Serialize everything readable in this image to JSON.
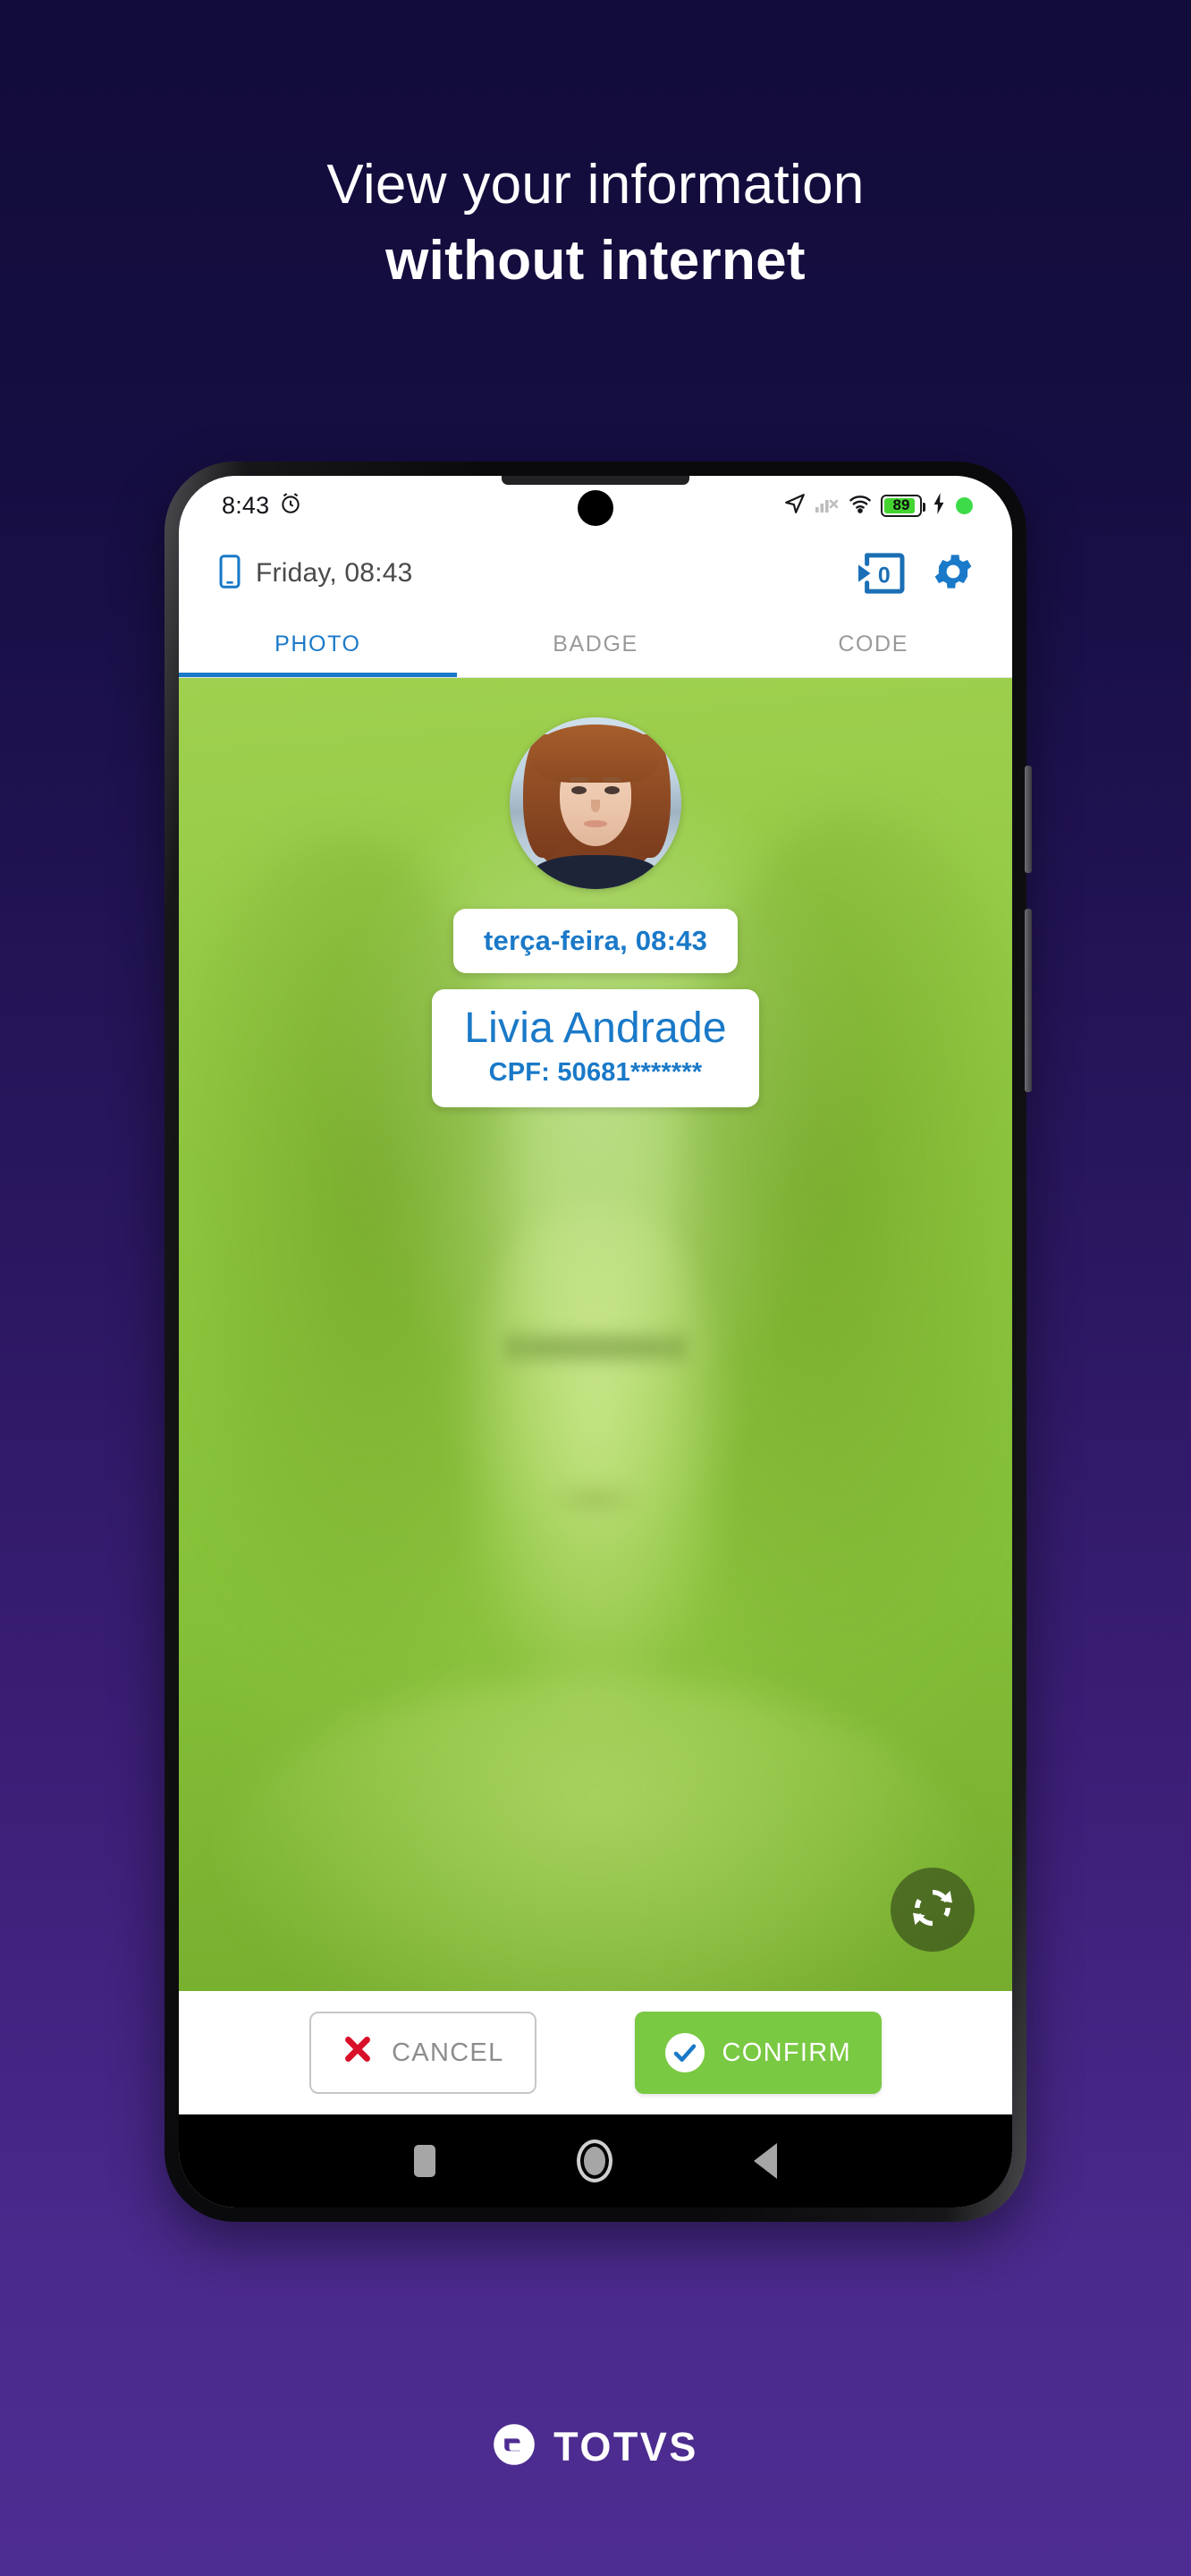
{
  "promo": {
    "headline_line1": "View your information",
    "headline_line2": "without internet"
  },
  "phone": {
    "statusbar": {
      "time": "8:43",
      "alarm_icon": "alarm-icon",
      "location_icon": "location-arrow-icon",
      "signal_icon": "signal-no-service-icon",
      "wifi_icon": "wifi-icon",
      "battery_percent": "89",
      "charging_icon": "charging-bolt-icon",
      "recording_dot": "green-status-dot"
    },
    "appbar": {
      "device_icon": "mobile-device-icon",
      "title": "Friday, 08:43",
      "queue_icon": "pending-records-icon",
      "queue_count": "0",
      "settings_icon": "gear-icon"
    },
    "tabs": [
      {
        "label": "PHOTO",
        "active": true
      },
      {
        "label": "BADGE",
        "active": false
      },
      {
        "label": "CODE",
        "active": false
      }
    ],
    "camera": {
      "avatar_icon": "user-avatar-photo",
      "date_card": "terça-feira, 08:43",
      "name": "Livia Andrade",
      "cpf": "CPF: 50681*******",
      "flip_icon": "flip-camera-icon"
    },
    "actions": {
      "cancel_label": "CANCEL",
      "cancel_icon": "red-x-icon",
      "confirm_label": "CONFIRM",
      "confirm_icon": "blue-check-icon"
    },
    "navbar": {
      "recents_icon": "recents-square-icon",
      "home_icon": "home-circle-icon",
      "back_icon": "back-triangle-icon"
    }
  },
  "footer": {
    "brand": "TOTVS",
    "brand_icon": "totvs-logo-icon"
  },
  "colors": {
    "accent_blue": "#1a79c8",
    "accent_green": "#7ac943",
    "camera_green": "#8cc63e",
    "bg_top": "#120c3a",
    "bg_bottom": "#4e2d92"
  }
}
